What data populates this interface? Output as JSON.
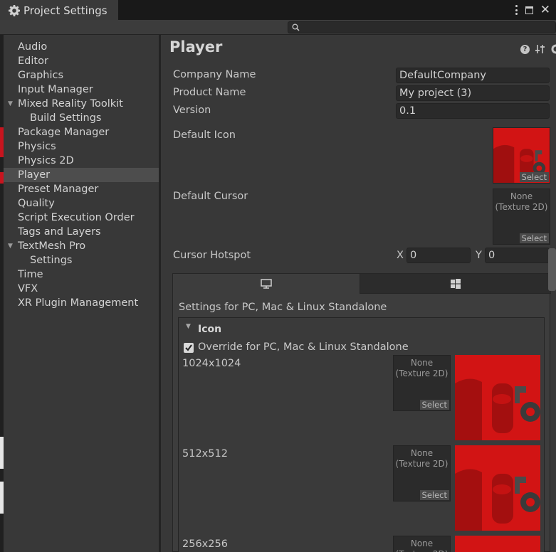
{
  "window": {
    "tab_title": "Project Settings",
    "tab_icon": "gear-icon",
    "search": {
      "value": "",
      "placeholder": ""
    }
  },
  "sidebar": {
    "items": [
      {
        "label": "Audio",
        "indent": 0,
        "selected": false
      },
      {
        "label": "Editor",
        "indent": 0,
        "selected": false
      },
      {
        "label": "Graphics",
        "indent": 0,
        "selected": false
      },
      {
        "label": "Input Manager",
        "indent": 0,
        "selected": false
      },
      {
        "label": "Mixed Reality Toolkit",
        "indent": 0,
        "expanded": true,
        "selected": false
      },
      {
        "label": "Build Settings",
        "indent": 1,
        "selected": false
      },
      {
        "label": "Package Manager",
        "indent": 0,
        "selected": false
      },
      {
        "label": "Physics",
        "indent": 0,
        "selected": false
      },
      {
        "label": "Physics 2D",
        "indent": 0,
        "selected": false
      },
      {
        "label": "Player",
        "indent": 0,
        "selected": true
      },
      {
        "label": "Preset Manager",
        "indent": 0,
        "selected": false
      },
      {
        "label": "Quality",
        "indent": 0,
        "selected": false
      },
      {
        "label": "Script Execution Order",
        "indent": 0,
        "selected": false
      },
      {
        "label": "Tags and Layers",
        "indent": 0,
        "selected": false
      },
      {
        "label": "TextMesh Pro",
        "indent": 0,
        "expanded": true,
        "selected": false
      },
      {
        "label": "Settings",
        "indent": 1,
        "selected": false
      },
      {
        "label": "Time",
        "indent": 0,
        "selected": false
      },
      {
        "label": "VFX",
        "indent": 0,
        "selected": false
      },
      {
        "label": "XR Plugin Management",
        "indent": 0,
        "selected": false
      }
    ]
  },
  "player": {
    "title": "Player",
    "company_name_label": "Company Name",
    "company_name": "DefaultCompany",
    "product_name_label": "Product Name",
    "product_name": "My project (3)",
    "version_label": "Version",
    "version": "0.1",
    "default_icon_label": "Default Icon",
    "default_cursor_label": "Default Cursor",
    "cursor_hotspot_label": "Cursor Hotspot",
    "hotspot_x_label": "X",
    "hotspot_x": "0",
    "hotspot_y_label": "Y",
    "hotspot_y": "0",
    "select_label": "Select",
    "none_texture_line1": "None",
    "none_texture_line2": "(Texture 2D)",
    "platform_tabs": [
      {
        "icon": "monitor-icon",
        "active": true
      },
      {
        "icon": "windows-icon",
        "active": false
      }
    ],
    "platform_heading": "Settings for PC, Mac & Linux Standalone",
    "icon_section_title": "Icon",
    "override_label": "Override for PC, Mac & Linux Standalone",
    "override_checked": true,
    "icon_sizes": [
      "1024x1024",
      "512x512",
      "256x256"
    ]
  },
  "colors": {
    "background": "#383838",
    "field": "#2a2a2a",
    "selected_row": "#4d4d4d",
    "icon_red": "#d21414"
  }
}
